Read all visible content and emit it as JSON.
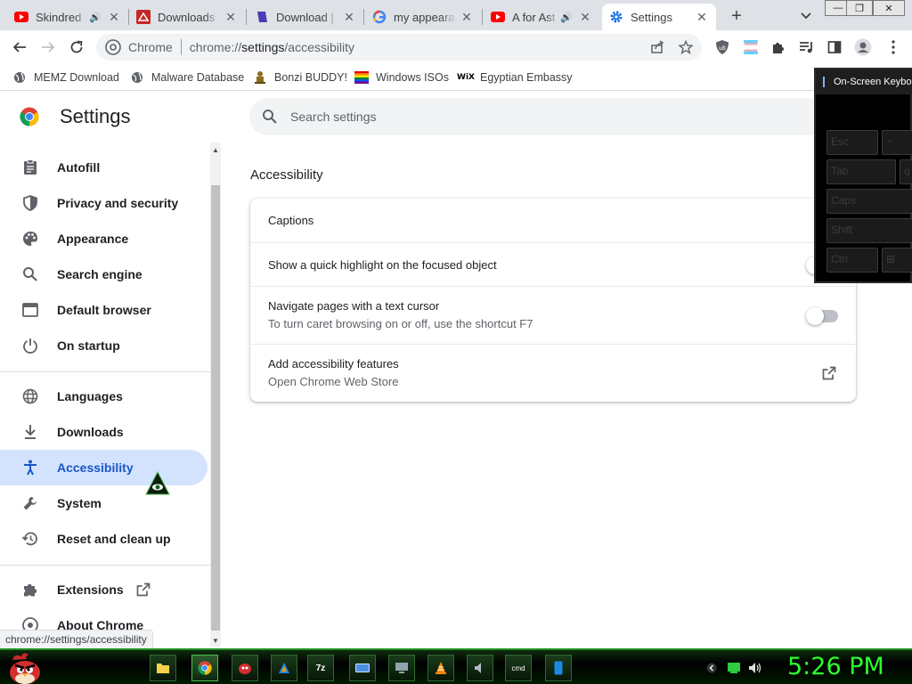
{
  "tabs": [
    {
      "label": "Skindred",
      "icon": "youtube-icon",
      "sound": true
    },
    {
      "label": "Downloads -",
      "icon": "pdf-icon",
      "sound": false
    },
    {
      "label": "Download | f",
      "icon": "download-site-icon",
      "sound": false
    },
    {
      "label": "my appearan",
      "icon": "google-icon",
      "sound": false
    },
    {
      "label": "A for Ast",
      "icon": "youtube-icon",
      "sound": true
    },
    {
      "label": "Settings",
      "icon": "gear-icon",
      "sound": false,
      "active": true
    }
  ],
  "window_controls": {
    "minimize": "—",
    "restore": "❐",
    "close": "✕"
  },
  "omnibox": {
    "site_label": "Chrome",
    "url_prefix": "chrome://",
    "url_host": "settings",
    "url_path": "/accessibility"
  },
  "bookmarks": [
    {
      "label": "MEMZ Download",
      "icon": "globe-icon"
    },
    {
      "label": "Malware Database",
      "icon": "globe-icon"
    },
    {
      "label": "Bonzi BUDDY!",
      "icon": "bonzi-icon"
    },
    {
      "label": "Windows ISOs",
      "icon": "rainbow-flag-icon"
    },
    {
      "label": "Egyptian Embassy",
      "icon": "wix-icon"
    }
  ],
  "settings": {
    "title": "Settings",
    "search_placeholder": "Search settings"
  },
  "sidebar": {
    "items": [
      {
        "label": "Autofill",
        "icon": "clipboard-icon"
      },
      {
        "label": "Privacy and security",
        "icon": "shield-icon"
      },
      {
        "label": "Appearance",
        "icon": "palette-icon"
      },
      {
        "label": "Search engine",
        "icon": "search-icon"
      },
      {
        "label": "Default browser",
        "icon": "browser-window-icon"
      },
      {
        "label": "On startup",
        "icon": "power-icon"
      },
      {
        "label": "Languages",
        "icon": "globe-icon"
      },
      {
        "label": "Downloads",
        "icon": "download-icon"
      },
      {
        "label": "Accessibility",
        "icon": "accessibility-icon",
        "active": true
      },
      {
        "label": "System",
        "icon": "wrench-icon"
      },
      {
        "label": "Reset and clean up",
        "icon": "history-icon"
      },
      {
        "label": "Extensions",
        "icon": "puzzle-icon"
      },
      {
        "label": "About Chrome",
        "icon": "chrome-icon"
      }
    ]
  },
  "main": {
    "section_title": "Accessibility",
    "rows": [
      {
        "label": "Captions",
        "sub": ""
      },
      {
        "label": "Show a quick highlight on the focused object",
        "sub": "",
        "toggle": false
      },
      {
        "label": "Navigate pages with a text cursor",
        "sub": "To turn caret browsing on or off, use the shortcut F7",
        "toggle": false
      },
      {
        "label": "Add accessibility features",
        "sub": "Open Chrome Web Store"
      }
    ]
  },
  "osk": {
    "title": "On-Screen Keyboard",
    "keys": [
      "Esc",
      "~",
      "Tab",
      "q",
      "Caps",
      "Shift",
      "Ctrl",
      "⊞"
    ]
  },
  "status_url": "chrome://settings/accessibility",
  "taskbar": {
    "apps": [
      "folder-icon",
      "chrome-icon",
      "angry-birds-icon",
      "winamp-icon",
      "7z",
      "keyboard-icon",
      "computer-icon",
      "vlc-icon",
      "speaker-icon",
      "cmd",
      "phone-icon"
    ],
    "clock": "5:26 PM"
  },
  "colors": {
    "accent": "#1a56c9",
    "active_nav_bg": "#d3e3fd",
    "clock": "#2cff2c"
  }
}
